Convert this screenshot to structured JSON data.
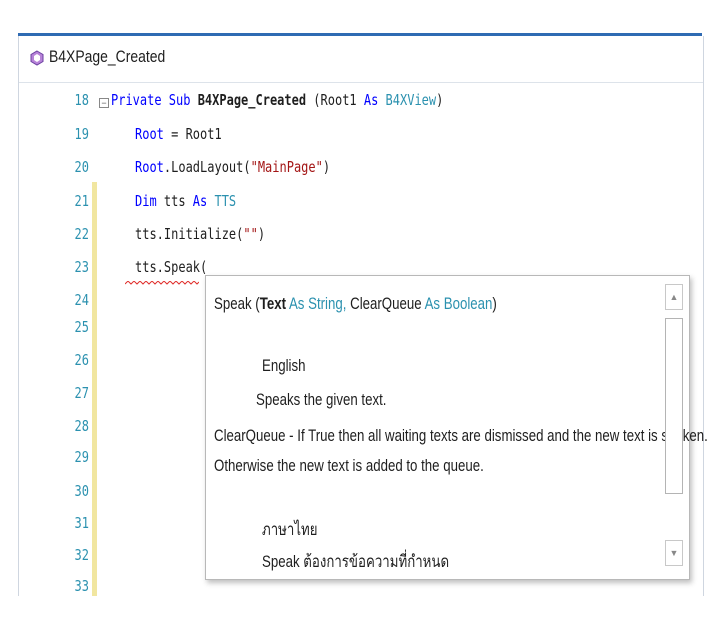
{
  "procedure": {
    "name": "B4XPage_Created",
    "icon": "cube-icon"
  },
  "gutter": {
    "line_numbers": [
      "18",
      "19",
      "20",
      "21",
      "22",
      "23",
      "24",
      "25",
      "26",
      "27",
      "28",
      "29",
      "30",
      "31",
      "32",
      "33"
    ],
    "changed_marker_color": "#f1e6a0"
  },
  "code": {
    "line18": {
      "kw1": "Private Sub ",
      "name": "B4XPage_Created",
      "open": " (Root1 ",
      "kw2": "As ",
      "type": "B4XView",
      "close": ")"
    },
    "line19": {
      "var": "Root",
      "rest": " = Root1"
    },
    "line20": {
      "var": "Root",
      "call": ".LoadLayout(",
      "str": "\"MainPage\"",
      "close": ")"
    },
    "line21": {
      "kw1": "Dim",
      "mid": " tts ",
      "kw2": "As ",
      "type": "TTS"
    },
    "line22": {
      "text": "tts.Initialize(",
      "str": "\"\"",
      "close": ")"
    },
    "line23": {
      "text": "tts.Speak("
    }
  },
  "colors": {
    "keyword": "#0000ff",
    "type": "#2b91af",
    "string": "#a31515",
    "accent": "#2f6bb3"
  },
  "tooltip": {
    "sig_name": "Speak (",
    "sig_p1": "Text",
    "sig_as1": " As ",
    "sig_t1": "String,",
    "sig_p2": " ClearQueue ",
    "sig_as2": "As ",
    "sig_t2": "Boolean",
    "sig_close": ")",
    "en_heading": "English",
    "en_desc": "Speaks the given text.",
    "en_clear": "ClearQueue - If True then all waiting texts are dismissed and the new text is spoken.",
    "en_other": "Otherwise the new text is added to the queue.",
    "th_heading": "ภาษาไทย",
    "th_desc": "Speak ต้องการข้อความที่กำหนด",
    "scroll_up_icon": "triangle-up-icon",
    "scroll_down_icon": "triangle-down-icon"
  }
}
